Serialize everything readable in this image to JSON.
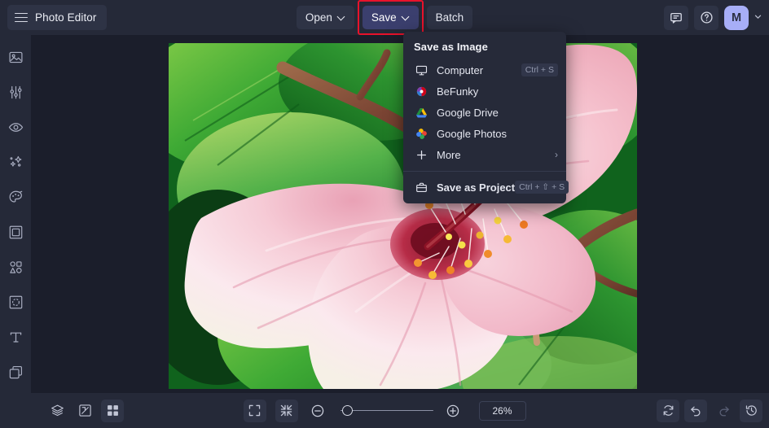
{
  "app": {
    "brand_label": "Photo Editor",
    "brand_icon": "hamburger-menu-icon"
  },
  "toolbar": {
    "open_label": "Open",
    "save_label": "Save",
    "batch_label": "Batch",
    "open_caret_icon": "chevron-down-icon",
    "save_caret_icon": "chevron-down-icon",
    "feedback_icon": "speech-bubble-icon",
    "help_icon": "question-circle-icon",
    "avatar_initial": "M",
    "account_caret_icon": "chevron-down-icon",
    "highlight_color": "#e8122b",
    "save_active_color": "#3b3f6e",
    "avatar_color": "#a7aef7"
  },
  "save_menu": {
    "title": "Save as Image",
    "items": [
      {
        "label": "Computer",
        "icon": "monitor-icon",
        "shortcut": "Ctrl + S"
      },
      {
        "label": "BeFunky",
        "icon": "befunky-logo-icon",
        "shortcut": ""
      },
      {
        "label": "Google Drive",
        "icon": "google-drive-icon",
        "shortcut": ""
      },
      {
        "label": "Google Photos",
        "icon": "google-photos-icon",
        "shortcut": ""
      },
      {
        "label": "More",
        "icon": "plus-icon",
        "shortcut": "",
        "arrow": "›"
      }
    ],
    "project_item": {
      "label": "Save as Project",
      "icon": "briefcase-icon",
      "shortcut": "Ctrl + ⇧ + S"
    }
  },
  "sidebar": {
    "items": [
      {
        "name": "edit",
        "icon": "image-icon"
      },
      {
        "name": "adjust",
        "icon": "sliders-icon"
      },
      {
        "name": "retouch",
        "icon": "eye-icon"
      },
      {
        "name": "effects",
        "icon": "sparkles-icon"
      },
      {
        "name": "artsy",
        "icon": "palette-icon"
      },
      {
        "name": "frames",
        "icon": "frame-icon"
      },
      {
        "name": "graphics",
        "icon": "shapes-icon"
      },
      {
        "name": "overlays",
        "icon": "overlay-icon"
      },
      {
        "name": "text",
        "icon": "text-t-icon"
      },
      {
        "name": "layers",
        "icon": "layers-stack-icon"
      }
    ]
  },
  "bottombar": {
    "left_tools": [
      {
        "name": "layers",
        "icon": "layers-icon",
        "active": false
      },
      {
        "name": "compare",
        "icon": "compare-icon",
        "active": false
      },
      {
        "name": "grid",
        "icon": "grid-icon",
        "active": true
      }
    ],
    "fit_icon": "fit-to-screen-icon",
    "actual_icon": "shrink-icon",
    "zoom_out_icon": "minus-circle-icon",
    "zoom_in_icon": "plus-circle-icon",
    "zoom_value": "26%",
    "slider_position_percent": 6,
    "right_tools": [
      {
        "name": "reset",
        "icon": "reset-rotate-icon",
        "enabled": true
      },
      {
        "name": "undo",
        "icon": "undo-arrow-icon",
        "enabled": true
      },
      {
        "name": "redo",
        "icon": "redo-arrow-icon",
        "enabled": false
      },
      {
        "name": "history",
        "icon": "history-clock-icon",
        "enabled": true
      }
    ]
  },
  "canvas": {
    "image_description": "Painted pink hibiscus flower with green leaves"
  }
}
